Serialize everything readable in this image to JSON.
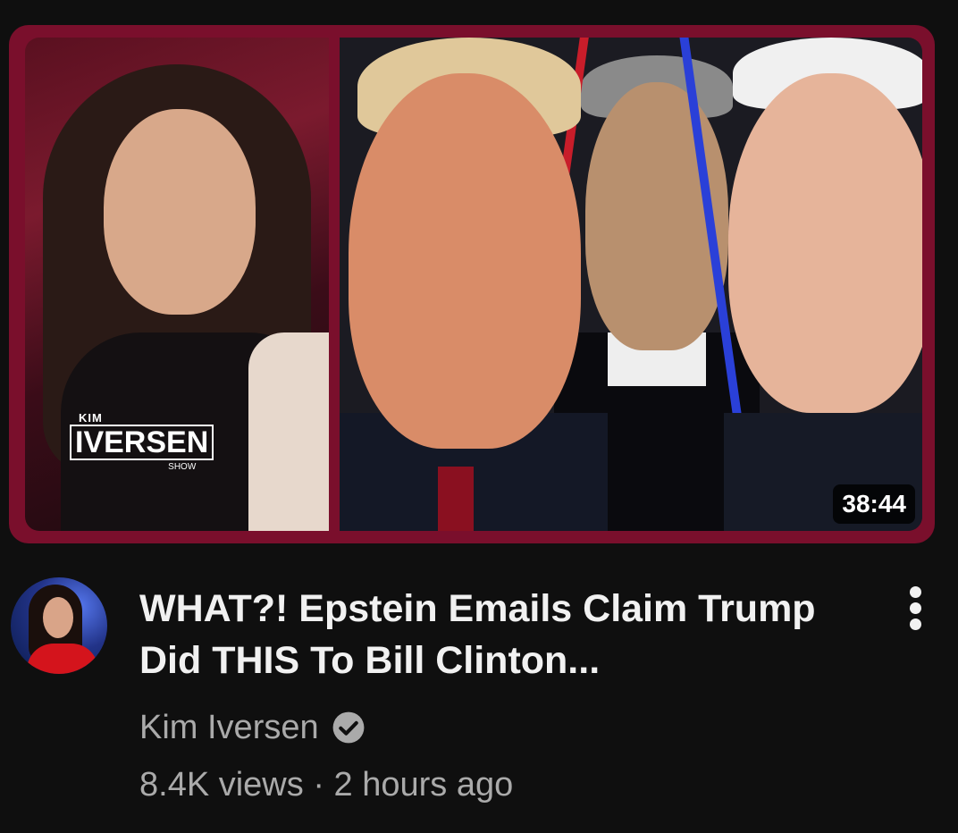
{
  "thumbnail": {
    "logo": {
      "kim": "KIM",
      "main": "IVERSEN",
      "show": "SHOW"
    },
    "duration": "38:44",
    "border_color": "#7a0f2c"
  },
  "video": {
    "title": "WHAT?! Epstein Emails Claim Trump Did THIS To Bill Clinton...",
    "channel_name": "Kim Iversen",
    "views": "8.4K views",
    "separator": "·",
    "age": "2 hours ago"
  },
  "icons": {
    "verified": "check-circle-icon",
    "menu": "more-vert-icon"
  },
  "colors": {
    "background": "#0f0f0f",
    "title": "#f1f1f1",
    "secondary_text": "#aaaaaa"
  }
}
